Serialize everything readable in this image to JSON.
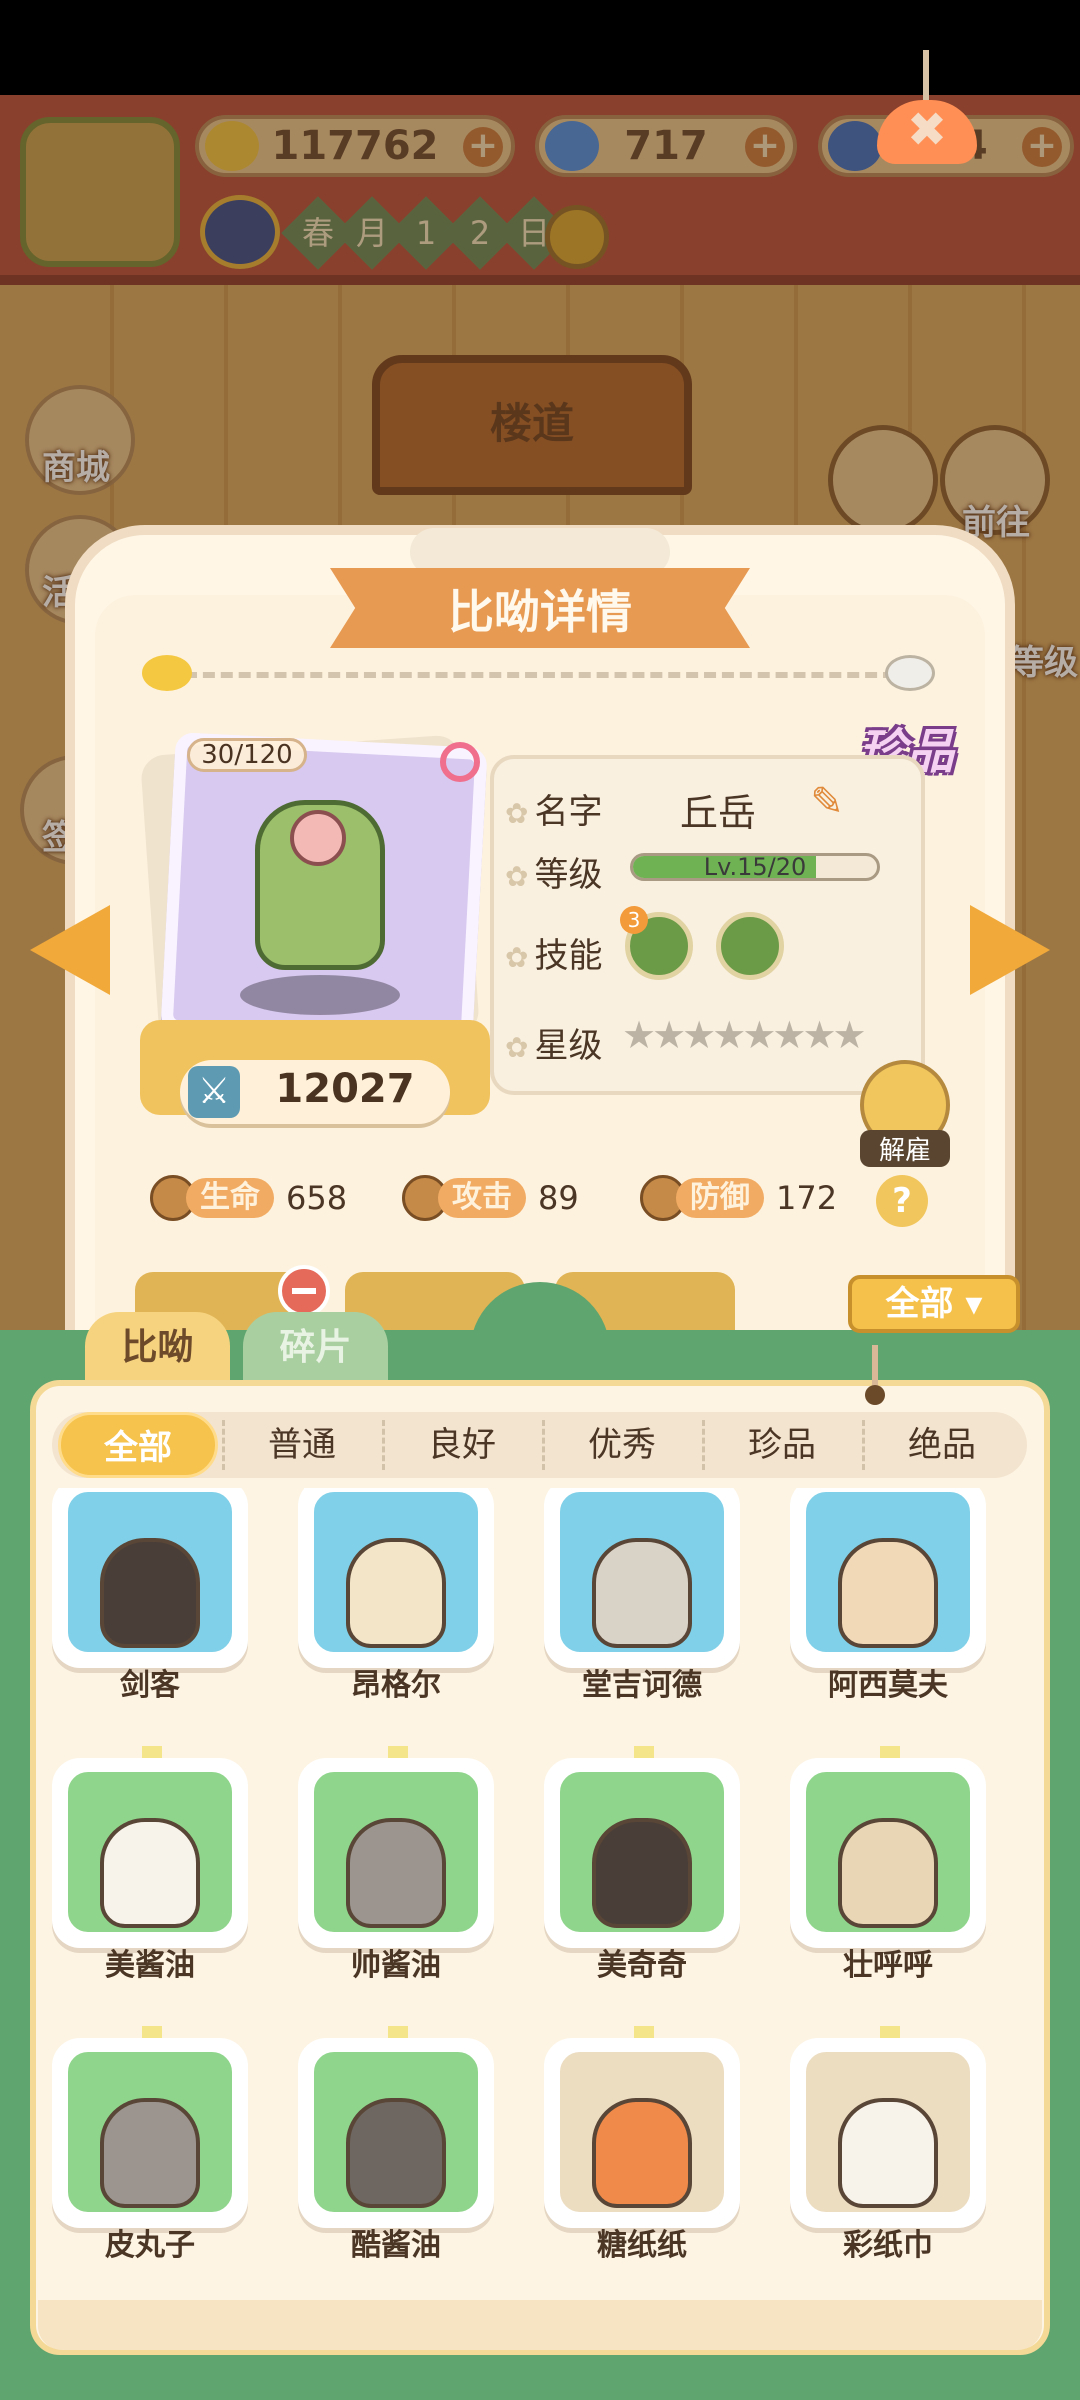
{
  "header": {
    "resources": [
      {
        "icon": "banana-icon",
        "value": "117762"
      },
      {
        "icon": "blue-flame-icon",
        "value": "717"
      },
      {
        "icon": "fish-icon",
        "value": "234"
      }
    ],
    "date": {
      "cells": [
        "春",
        "月",
        "1",
        "2",
        "日"
      ]
    }
  },
  "background": {
    "side_buttons": [
      "商城",
      "活",
      "签",
      "前往",
      "等级"
    ],
    "stairs_label": "楼道"
  },
  "detail": {
    "title": "比呦详情",
    "rarity": "珍品",
    "exp": "30/120",
    "power": "12027",
    "labels": {
      "name": "名字",
      "level": "等级",
      "skill": "技能",
      "star": "星级"
    },
    "name": "丘岳",
    "level_text": "Lv.15/20",
    "level_fraction": 0.75,
    "skill_badge": "3",
    "stars_total": 8,
    "fire_label": "解雇",
    "stats": [
      {
        "label": "生命",
        "value": "658"
      },
      {
        "label": "攻击",
        "value": "89"
      },
      {
        "label": "防御",
        "value": "172"
      }
    ],
    "help_label": "?",
    "filter_label": "全部"
  },
  "drawer": {
    "tabs": [
      "比呦",
      "碎片"
    ],
    "filters": [
      "全部",
      "普通",
      "良好",
      "优秀",
      "珍品",
      "绝品"
    ],
    "items": [
      {
        "name": "剑客",
        "bg": "blue",
        "char_color": "#4a3f38"
      },
      {
        "name": "昂格尔",
        "bg": "blue",
        "char_color": "#f3e6c8"
      },
      {
        "name": "堂吉诃德",
        "bg": "blue",
        "char_color": "#d9d2c6"
      },
      {
        "name": "阿西莫夫",
        "bg": "blue",
        "char_color": "#f1d9b8"
      },
      {
        "name": "美酱油",
        "bg": "green",
        "char_color": "#f7f2ea"
      },
      {
        "name": "帅酱油",
        "bg": "green",
        "char_color": "#9b948f"
      },
      {
        "name": "美奇奇",
        "bg": "green",
        "char_color": "#4a3f38"
      },
      {
        "name": "壮呼呼",
        "bg": "green",
        "char_color": "#e9d6b4"
      },
      {
        "name": "皮丸子",
        "bg": "green",
        "char_color": "#9b948f"
      },
      {
        "name": "酷酱油",
        "bg": "green",
        "char_color": "#6e6660"
      },
      {
        "name": "糖纸纸",
        "bg": "locked",
        "char_color": "#f08a4a"
      },
      {
        "name": "彩纸巾",
        "bg": "locked",
        "char_color": "#f7f2ea"
      }
    ]
  }
}
